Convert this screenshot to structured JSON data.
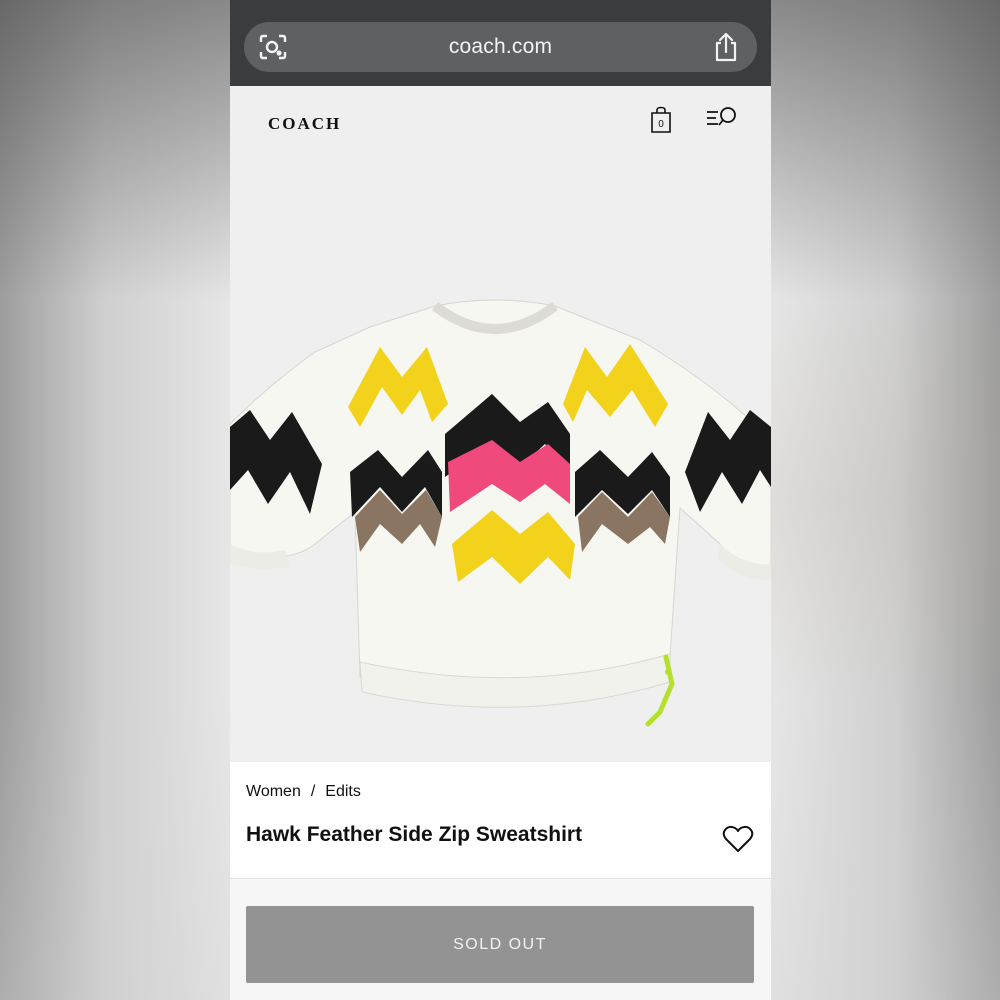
{
  "browser": {
    "url": "coach.com",
    "icons": {
      "lens": "lens-icon",
      "share": "share-icon"
    }
  },
  "header": {
    "logo": "COACH",
    "icons": {
      "bag": "shopping-bag-icon",
      "menu_search": "menu-search-icon"
    },
    "bag_count": "0"
  },
  "product": {
    "breadcrumb": [
      "Women",
      "Edits"
    ],
    "breadcrumb_separator": "/",
    "title": "Hawk Feather Side Zip Sweatshirt",
    "image_alt": "white sweatshirt with yellow, black and pink chevron pattern",
    "wishlist_icon": "heart-icon",
    "status_button": "SOLD OUT"
  },
  "colors": {
    "browser_chrome": "#3a3d3f",
    "url_pill": "#5e6163",
    "sold_out_button": "#939393",
    "chevron_yellow": "#f2d21a",
    "chevron_pink": "#f0497c",
    "chevron_black": "#1a1a1a",
    "zip_pull": "#b5e02e"
  }
}
